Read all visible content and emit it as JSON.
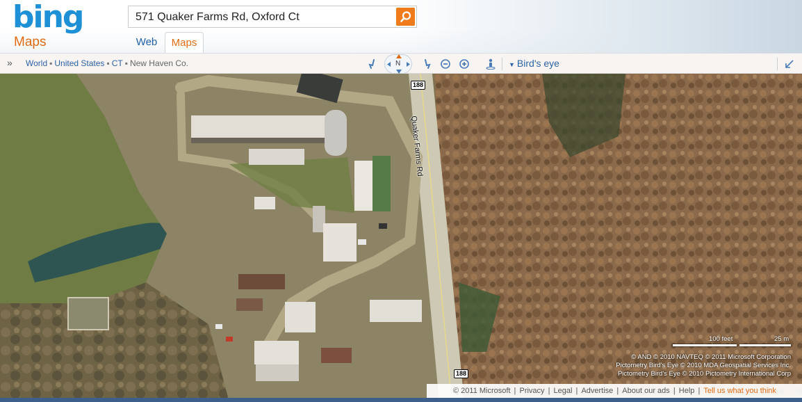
{
  "brand": {
    "logo": "bing",
    "product": "Maps"
  },
  "search": {
    "value": "571 Quaker Farms Rd, Oxford Ct",
    "button_icon": "search-icon"
  },
  "tabs": [
    {
      "label": "Web",
      "active": false
    },
    {
      "label": "Maps",
      "active": true
    }
  ],
  "breadcrumbs": [
    {
      "label": "World",
      "link": true
    },
    {
      "label": "United States",
      "link": true
    },
    {
      "label": "CT",
      "link": true
    },
    {
      "label": "New Haven Co.",
      "link": false
    }
  ],
  "toolbar": {
    "compass_label": "N",
    "view_label": "Bird's eye"
  },
  "map": {
    "road_label": "Quaker Farms Rd",
    "route_shield_top": "188",
    "route_shield_bottom": "188",
    "scale": {
      "feet": "100 feet",
      "meters": "25 m"
    },
    "credits": [
      "© AND  © 2010 NAVTEQ  © 2011 Microsoft Corporation",
      "Pictometry Bird's Eye © 2010 MDA Geospatial Services Inc.",
      "Pictometry Bird's Eye © 2010 Pictometry International Corp"
    ]
  },
  "footer": {
    "copyright": "© 2011 Microsoft",
    "links": [
      "Privacy",
      "Legal",
      "Advertise",
      "About our ads",
      "Help"
    ],
    "feedback": "Tell us what you think"
  },
  "colors": {
    "brand_blue": "#1e90d6",
    "brand_orange": "#e06b12",
    "link_blue": "#2e63a6"
  }
}
